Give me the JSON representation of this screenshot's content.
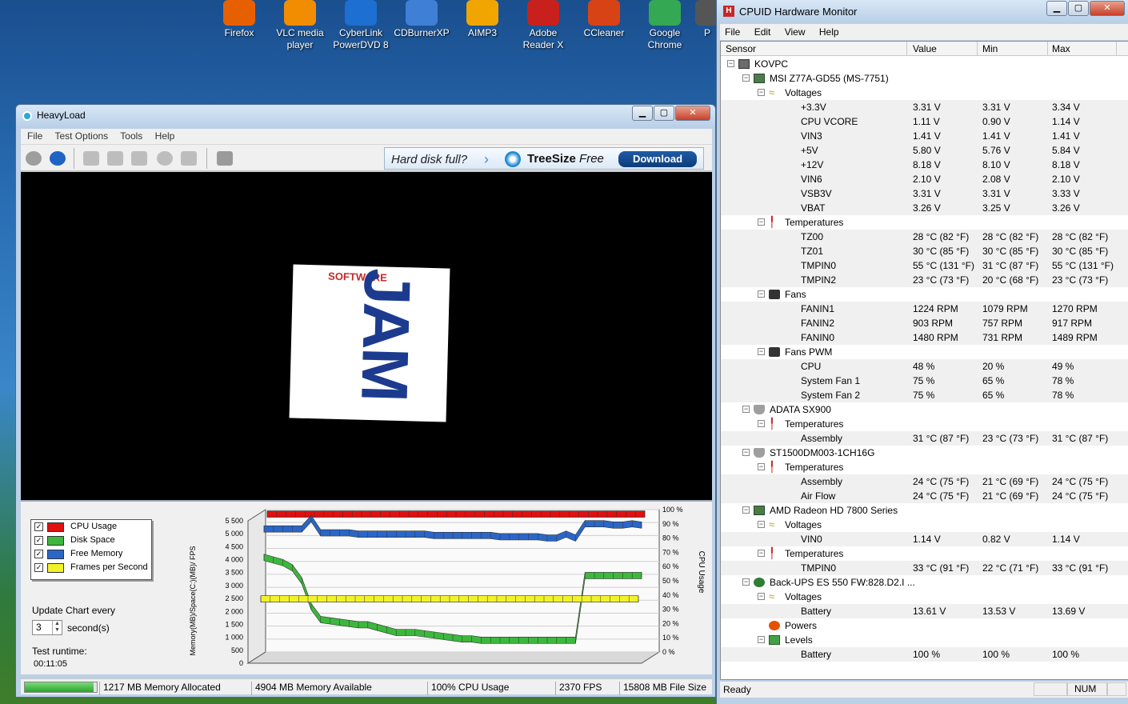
{
  "desktop": {
    "icons": [
      {
        "label": "Firefox",
        "color": "#e66000"
      },
      {
        "label": "VLC media player",
        "color": "#f28c00"
      },
      {
        "label": "CyberLink PowerDVD 8",
        "color": "#1d6fd1"
      },
      {
        "label": "CDBurnerXP",
        "color": "#3f7fd6"
      },
      {
        "label": "AIMP3",
        "color": "#f0a500"
      },
      {
        "label": "Adobe Reader X",
        "color": "#c7201d"
      },
      {
        "label": "CCleaner",
        "color": "#d84315"
      },
      {
        "label": "Google Chrome",
        "color": "#34a853"
      },
      {
        "label": "P",
        "color": "#555555"
      }
    ]
  },
  "heavyload": {
    "title": "HeavyLoad",
    "menu": [
      "File",
      "Test Options",
      "Tools",
      "Help"
    ],
    "ad": {
      "question": "Hard disk full?",
      "brand_bold": "TreeSize",
      "brand_rest": " Free",
      "button": "Download"
    },
    "logo": {
      "word": "JAM",
      "sub": "SOFTWARE"
    },
    "legend": [
      {
        "label": "CPU Usage",
        "color": "#e01010",
        "checked": "✓"
      },
      {
        "label": "Disk Space",
        "color": "#3cb83c",
        "checked": "✓"
      },
      {
        "label": "Free Memory",
        "color": "#2a66c8",
        "checked": "✓"
      },
      {
        "label": "Frames per Second",
        "color": "#f2f22a",
        "checked": "✓"
      }
    ],
    "update_label": "Update Chart every",
    "update_value": "3",
    "update_unit": "second(s)",
    "runtime_label": "Test runtime:",
    "runtime_value": "00:11:05",
    "status": {
      "progress_fraction": 0.95,
      "memory_allocated": "1217 MB Memory Allocated",
      "memory_available": "4904 MB Memory Available",
      "cpu": "100% CPU Usage",
      "fps": "2370 FPS",
      "file_size": "15808 MB File Size"
    }
  },
  "chart_data": {
    "type": "line",
    "xlabel": "",
    "ylabel": "Memory(MB)/Space(C:)(MB)/ FPS",
    "y2label": "CPU Usage",
    "ylim": [
      0,
      5500
    ],
    "y2lim": [
      0,
      100
    ],
    "yticks": [
      "5 500",
      "5 000",
      "4 500",
      "4 000",
      "3 500",
      "3 000",
      "2 500",
      "2 000",
      "1 500",
      "1 000",
      "500",
      "0"
    ],
    "y2ticks": [
      "100 %",
      "90 %",
      "80 %",
      "70 %",
      "60 %",
      "50 %",
      "40 %",
      "30 %",
      "20 %",
      "10 %",
      "0 %"
    ],
    "series": [
      {
        "name": "CPU Usage",
        "color": "#e01010",
        "axis": "right",
        "values": [
          100,
          100,
          100,
          100,
          100,
          100,
          100,
          100,
          100,
          100,
          100,
          100,
          100,
          100,
          100,
          100,
          100,
          100,
          100,
          100,
          100,
          100,
          100,
          100,
          100,
          100,
          100,
          100,
          100,
          100,
          100,
          100,
          100,
          100,
          100,
          100,
          100,
          100,
          100,
          100,
          100
        ]
      },
      {
        "name": "Free Memory",
        "color": "#2a66c8",
        "axis": "left",
        "values": [
          5000,
          5000,
          5000,
          5000,
          5000,
          5400,
          4850,
          4850,
          4850,
          4850,
          4800,
          4800,
          4800,
          4800,
          4800,
          4800,
          4800,
          4800,
          4750,
          4750,
          4750,
          4750,
          4750,
          4750,
          4750,
          4700,
          4700,
          4700,
          4700,
          4700,
          4650,
          4650,
          4800,
          4650,
          5200,
          5200,
          5200,
          5150,
          5150,
          5200,
          5150
        ]
      },
      {
        "name": "Disk Space",
        "color": "#3cb83c",
        "axis": "left",
        "values": [
          3900,
          3800,
          3700,
          3500,
          3000,
          2000,
          1500,
          1450,
          1400,
          1350,
          1300,
          1300,
          1200,
          1100,
          1000,
          1000,
          1000,
          950,
          900,
          850,
          800,
          750,
          750,
          700,
          700,
          700,
          700,
          700,
          700,
          700,
          700,
          700,
          700,
          700,
          3200,
          3200,
          3200,
          3200,
          3200,
          3200,
          3200
        ]
      },
      {
        "name": "Frames per Second",
        "color": "#f2f22a",
        "axis": "left",
        "values": [
          2370,
          2370,
          2370,
          2370,
          2370,
          2370,
          2370,
          2370,
          2370,
          2370,
          2370,
          2370,
          2370,
          2370,
          2370,
          2370,
          2370,
          2370,
          2370,
          2370,
          2370,
          2370,
          2370,
          2370,
          2370,
          2370,
          2370,
          2370,
          2370,
          2370,
          2370,
          2370,
          2370,
          2370,
          2370,
          2370,
          2370,
          2370,
          2370,
          2370,
          2370
        ]
      }
    ]
  },
  "hwmonitor": {
    "title": "CPUID Hardware Monitor",
    "menu": [
      "File",
      "Edit",
      "View",
      "Help"
    ],
    "columns": [
      "Sensor",
      "Value",
      "Min",
      "Max"
    ],
    "rows": [
      {
        "label": "KOVPC",
        "icon": "pc-icon",
        "level": 0,
        "toggle": "−"
      },
      {
        "label": "MSI Z77A-GD55 (MS-7751)",
        "icon": "motherboard-icon",
        "level": 1,
        "toggle": "−"
      },
      {
        "label": "Voltages",
        "icon": "voltage-icon",
        "level": 2,
        "toggle": "−"
      },
      {
        "label": "+3.3V",
        "level": 3,
        "value": "3.31 V",
        "min": "3.31 V",
        "max": "3.34 V"
      },
      {
        "label": "CPU VCORE",
        "level": 3,
        "value": "1.11 V",
        "min": "0.90 V",
        "max": "1.14 V"
      },
      {
        "label": "VIN3",
        "level": 3,
        "value": "1.41 V",
        "min": "1.41 V",
        "max": "1.41 V"
      },
      {
        "label": "+5V",
        "level": 3,
        "value": "5.80 V",
        "min": "5.76 V",
        "max": "5.84 V"
      },
      {
        "label": "+12V",
        "level": 3,
        "value": "8.18 V",
        "min": "8.10 V",
        "max": "8.18 V"
      },
      {
        "label": "VIN6",
        "level": 3,
        "value": "2.10 V",
        "min": "2.08 V",
        "max": "2.10 V"
      },
      {
        "label": "VSB3V",
        "level": 3,
        "value": "3.31 V",
        "min": "3.31 V",
        "max": "3.33 V"
      },
      {
        "label": "VBAT",
        "level": 3,
        "value": "3.26 V",
        "min": "3.25 V",
        "max": "3.26 V"
      },
      {
        "label": "Temperatures",
        "icon": "temperature-icon",
        "level": 2,
        "toggle": "−"
      },
      {
        "label": "TZ00",
        "level": 3,
        "value": "28 °C  (82 °F)",
        "min": "28 °C  (82 °F)",
        "max": "28 °C  (82 °F)"
      },
      {
        "label": "TZ01",
        "level": 3,
        "value": "30 °C  (85 °F)",
        "min": "30 °C  (85 °F)",
        "max": "30 °C  (85 °F)"
      },
      {
        "label": "TMPIN0",
        "level": 3,
        "value": "55 °C  (131 °F)",
        "min": "31 °C  (87 °F)",
        "max": "55 °C  (131 °F)"
      },
      {
        "label": "TMPIN2",
        "level": 3,
        "value": "23 °C  (73 °F)",
        "min": "20 °C  (68 °F)",
        "max": "23 °C  (73 °F)"
      },
      {
        "label": "Fans",
        "icon": "fan-icon",
        "level": 2,
        "toggle": "−"
      },
      {
        "label": "FANIN1",
        "level": 3,
        "value": "1224 RPM",
        "min": "1079 RPM",
        "max": "1270 RPM"
      },
      {
        "label": "FANIN2",
        "level": 3,
        "value": "903 RPM",
        "min": "757 RPM",
        "max": "917 RPM"
      },
      {
        "label": "FANIN0",
        "level": 3,
        "value": "1480 RPM",
        "min": "731 RPM",
        "max": "1489 RPM"
      },
      {
        "label": "Fans PWM",
        "icon": "fan-pwm-icon",
        "level": 2,
        "toggle": "−"
      },
      {
        "label": "CPU",
        "level": 3,
        "value": "48 %",
        "min": "20 %",
        "max": "49 %"
      },
      {
        "label": "System Fan 1",
        "level": 3,
        "value": "75 %",
        "min": "65 %",
        "max": "78 %"
      },
      {
        "label": "System Fan 2",
        "level": 3,
        "value": "75 %",
        "min": "65 %",
        "max": "78 %"
      },
      {
        "label": "ADATA SX900",
        "icon": "disk-icon",
        "level": 1,
        "toggle": "−"
      },
      {
        "label": "Temperatures",
        "icon": "temperature-icon",
        "level": 2,
        "toggle": "−"
      },
      {
        "label": "Assembly",
        "level": 3,
        "value": "31 °C  (87 °F)",
        "min": "23 °C  (73 °F)",
        "max": "31 °C  (87 °F)"
      },
      {
        "label": "ST1500DM003-1CH16G",
        "icon": "disk-icon",
        "level": 1,
        "toggle": "−"
      },
      {
        "label": "Temperatures",
        "icon": "temperature-icon",
        "level": 2,
        "toggle": "−"
      },
      {
        "label": "Assembly",
        "level": 3,
        "value": "24 °C  (75 °F)",
        "min": "21 °C  (69 °F)",
        "max": "24 °C  (75 °F)"
      },
      {
        "label": "Air Flow",
        "level": 3,
        "value": "24 °C  (75 °F)",
        "min": "21 °C  (69 °F)",
        "max": "24 °C  (75 °F)"
      },
      {
        "label": "AMD Radeon HD 7800 Series",
        "icon": "gpu-icon",
        "level": 1,
        "toggle": "−"
      },
      {
        "label": "Voltages",
        "icon": "voltage-icon",
        "level": 2,
        "toggle": "−"
      },
      {
        "label": "VIN0",
        "level": 3,
        "value": "1.14 V",
        "min": "0.82 V",
        "max": "1.14 V"
      },
      {
        "label": "Temperatures",
        "icon": "temperature-icon",
        "level": 2,
        "toggle": "−"
      },
      {
        "label": "TMPIN0",
        "level": 3,
        "value": "33 °C  (91 °F)",
        "min": "22 °C  (71 °F)",
        "max": "33 °C  (91 °F)"
      },
      {
        "label": "Back-UPS ES 550 FW:828.D2.I ...",
        "icon": "ups-icon",
        "level": 1,
        "toggle": "−"
      },
      {
        "label": "Voltages",
        "icon": "voltage-icon",
        "level": 2,
        "toggle": "−"
      },
      {
        "label": "Battery",
        "level": 3,
        "value": "13.61 V",
        "min": "13.53 V",
        "max": "13.69 V"
      },
      {
        "label": "Powers",
        "icon": "power-icon",
        "level": 2,
        "toggle": ""
      },
      {
        "label": "Levels",
        "icon": "levels-icon",
        "level": 2,
        "toggle": "−"
      },
      {
        "label": "Battery",
        "level": 3,
        "value": "100 %",
        "min": "100 %",
        "max": "100 %"
      }
    ],
    "status_left": "Ready",
    "status_num": "NUM"
  }
}
